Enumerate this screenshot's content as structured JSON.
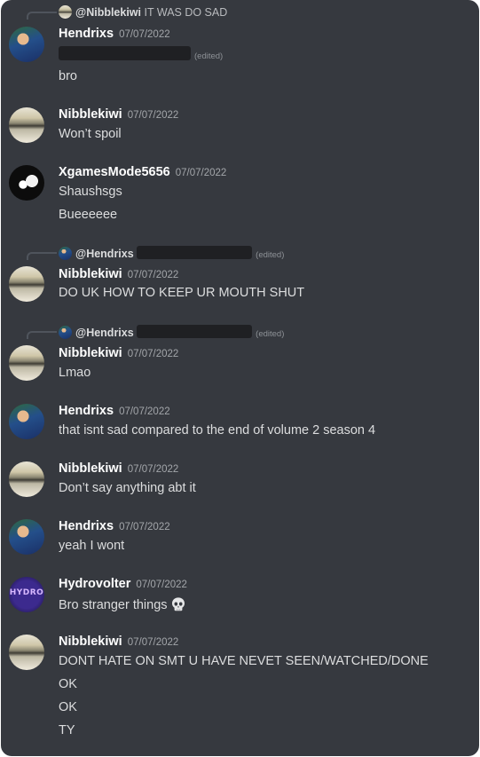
{
  "messages": [
    {
      "reply": {
        "username": "@Nibblekiwi",
        "text": "IT WAS DO SAD"
      },
      "username": "Hendrixs",
      "timestamp": "07/07/2022",
      "edited_label": "(edited)",
      "lines": [
        "bro"
      ]
    },
    {
      "username": "Nibblekiwi",
      "timestamp": "07/07/2022",
      "lines": [
        "Won’t spoil"
      ]
    },
    {
      "username": "XgamesMode5656",
      "timestamp": "07/07/2022",
      "lines": [
        "Shaushsgs",
        "Bueeeeee"
      ]
    },
    {
      "reply": {
        "username": "@Hendrixs",
        "edited_label": "(edited)"
      },
      "username": "Nibblekiwi",
      "timestamp": "07/07/2022",
      "lines": [
        "DO UK HOW TO KEEP UR MOUTH SHUT"
      ]
    },
    {
      "reply": {
        "username": "@Hendrixs",
        "edited_label": "(edited)"
      },
      "username": "Nibblekiwi",
      "timestamp": "07/07/2022",
      "lines": [
        "Lmao"
      ]
    },
    {
      "username": "Hendrixs",
      "timestamp": "07/07/2022",
      "lines": [
        "that isnt sad compared to the end of volume 2 season 4"
      ]
    },
    {
      "username": "Nibblekiwi",
      "timestamp": "07/07/2022",
      "lines": [
        "Don’t say anything abt it"
      ]
    },
    {
      "username": "Hendrixs",
      "timestamp": "07/07/2022",
      "lines": [
        "yeah I wont"
      ]
    },
    {
      "username": "Hydrovolter",
      "timestamp": "07/07/2022",
      "avatar_text": "HYDRO",
      "lines": [
        "Bro stranger things"
      ],
      "emoji": "skull-emoji"
    },
    {
      "username": "Nibblekiwi",
      "timestamp": "07/07/2022",
      "lines": [
        "DONT HATE ON SMT U HAVE NEVET SEEN/WATCHED/DONE",
        "OK",
        "OK",
        "TY"
      ]
    }
  ],
  "colors": {
    "background": "#36393f",
    "username": "#ffffff",
    "timestamp": "#a3a6aa",
    "text": "#dcddde",
    "redaction": "#1f2023"
  }
}
